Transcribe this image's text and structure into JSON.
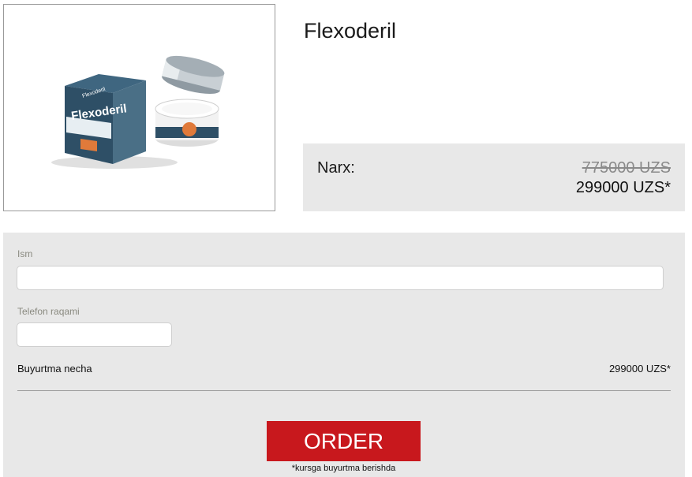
{
  "product": {
    "title": "Flexoderil",
    "image_alt": "Flexoderil cream box and jar",
    "package_text": "Flexoderil"
  },
  "price": {
    "label": "Narx:",
    "old": "775000 UZS",
    "new": "299000 UZS*"
  },
  "form": {
    "name_label": "Ism",
    "name_value": "",
    "phone_label": "Telefon raqami",
    "phone_value": "",
    "summary_label": "Buyurtma necha",
    "summary_value": "299000 UZS*",
    "button_label": "ORDER",
    "note": "*kursga buyurtma berishda"
  },
  "colors": {
    "accent": "#c8181d",
    "panel": "#e8e8e8",
    "package_blue": "#2e4f66"
  }
}
